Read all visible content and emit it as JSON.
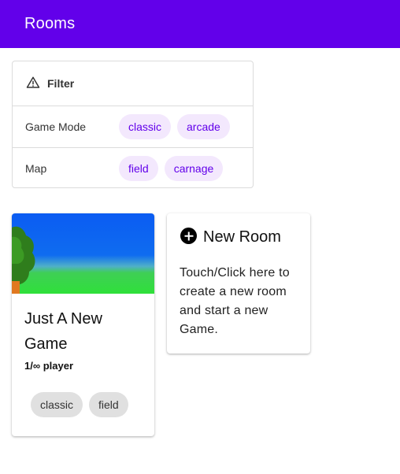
{
  "appbar": {
    "title": "Rooms",
    "color": "#6200ea"
  },
  "filter": {
    "title": "Filter",
    "icon": "warning-triangle-icon",
    "rows": [
      {
        "label": "Game Mode",
        "chips": [
          "classic",
          "arcade"
        ]
      },
      {
        "label": "Map",
        "chips": [
          "field",
          "carnage"
        ]
      }
    ]
  },
  "rooms": [
    {
      "title": "Just A New Game",
      "players": "1/∞ player",
      "tags": [
        "classic",
        "field"
      ],
      "image": "field-landscape-image"
    }
  ],
  "new_room": {
    "icon": "add-circle-icon",
    "title": "New Room",
    "description": "Touch/Click here to create a new room and start a new Game."
  }
}
